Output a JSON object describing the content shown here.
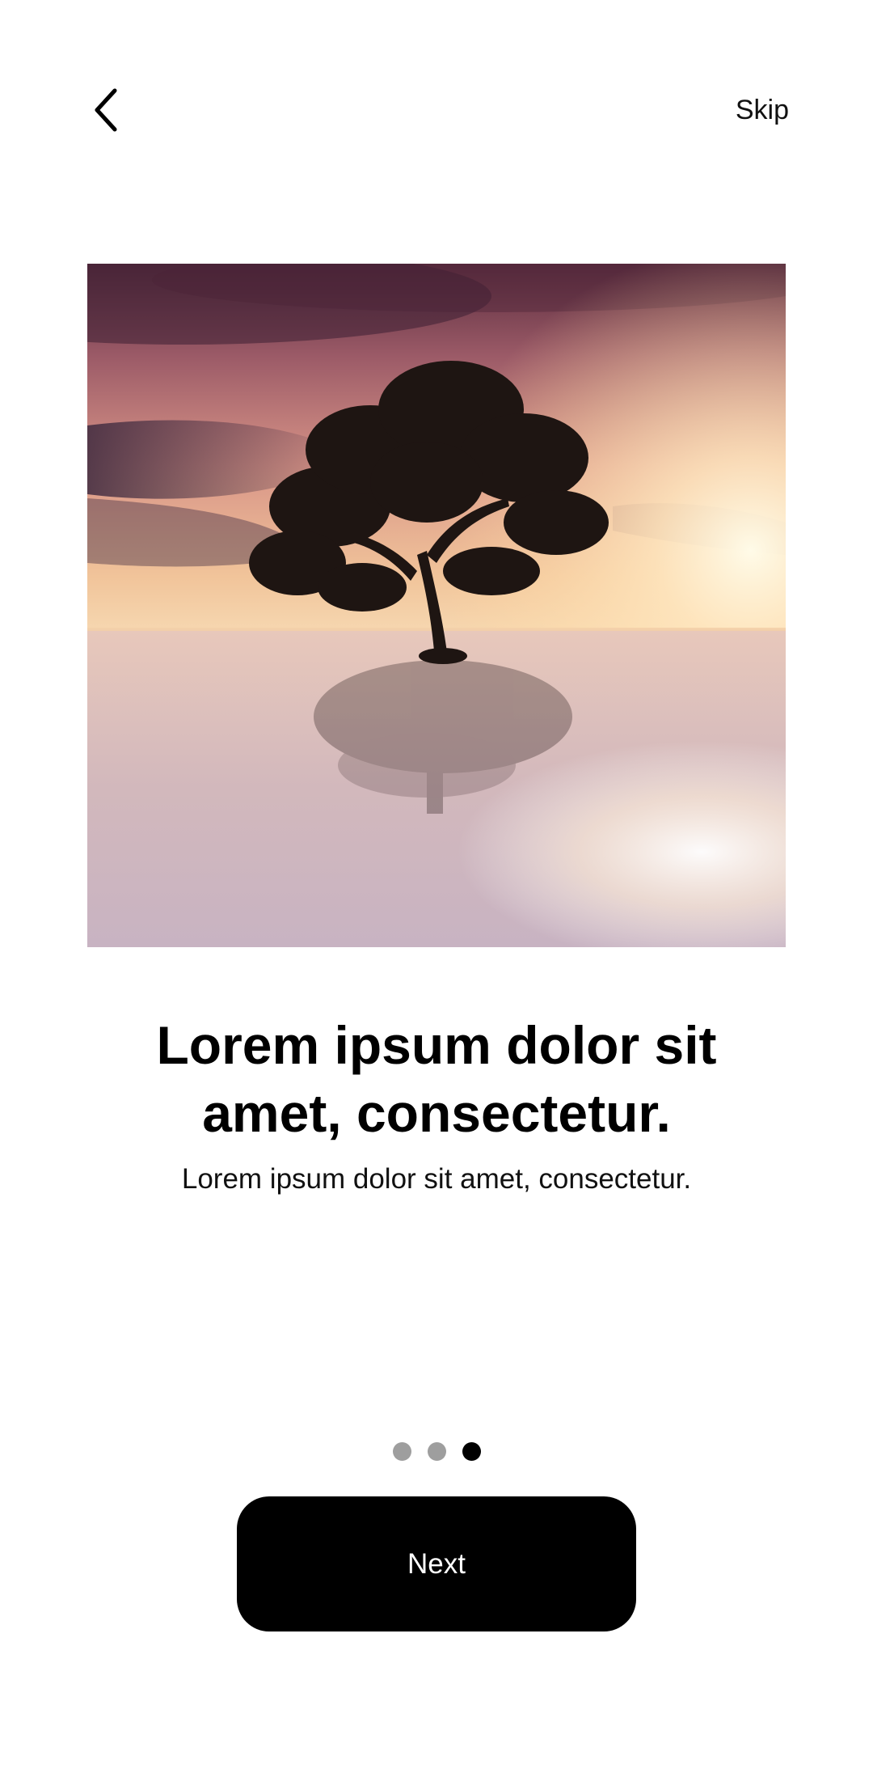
{
  "header": {
    "back_icon": "chevron-left-icon",
    "skip_label": "Skip"
  },
  "hero": {
    "image_subject": "lone tree standing in calm water at sunset"
  },
  "content": {
    "title": "Lorem ipsum dolor sit amet, consectetur.",
    "subtitle": "Lorem ipsum dolor sit amet, consectetur."
  },
  "pagination": {
    "total": 3,
    "active_index": 2,
    "active_color": "#000000",
    "inactive_color": "#9e9e9e"
  },
  "footer": {
    "next_label": "Next",
    "button_color": "#000000"
  }
}
